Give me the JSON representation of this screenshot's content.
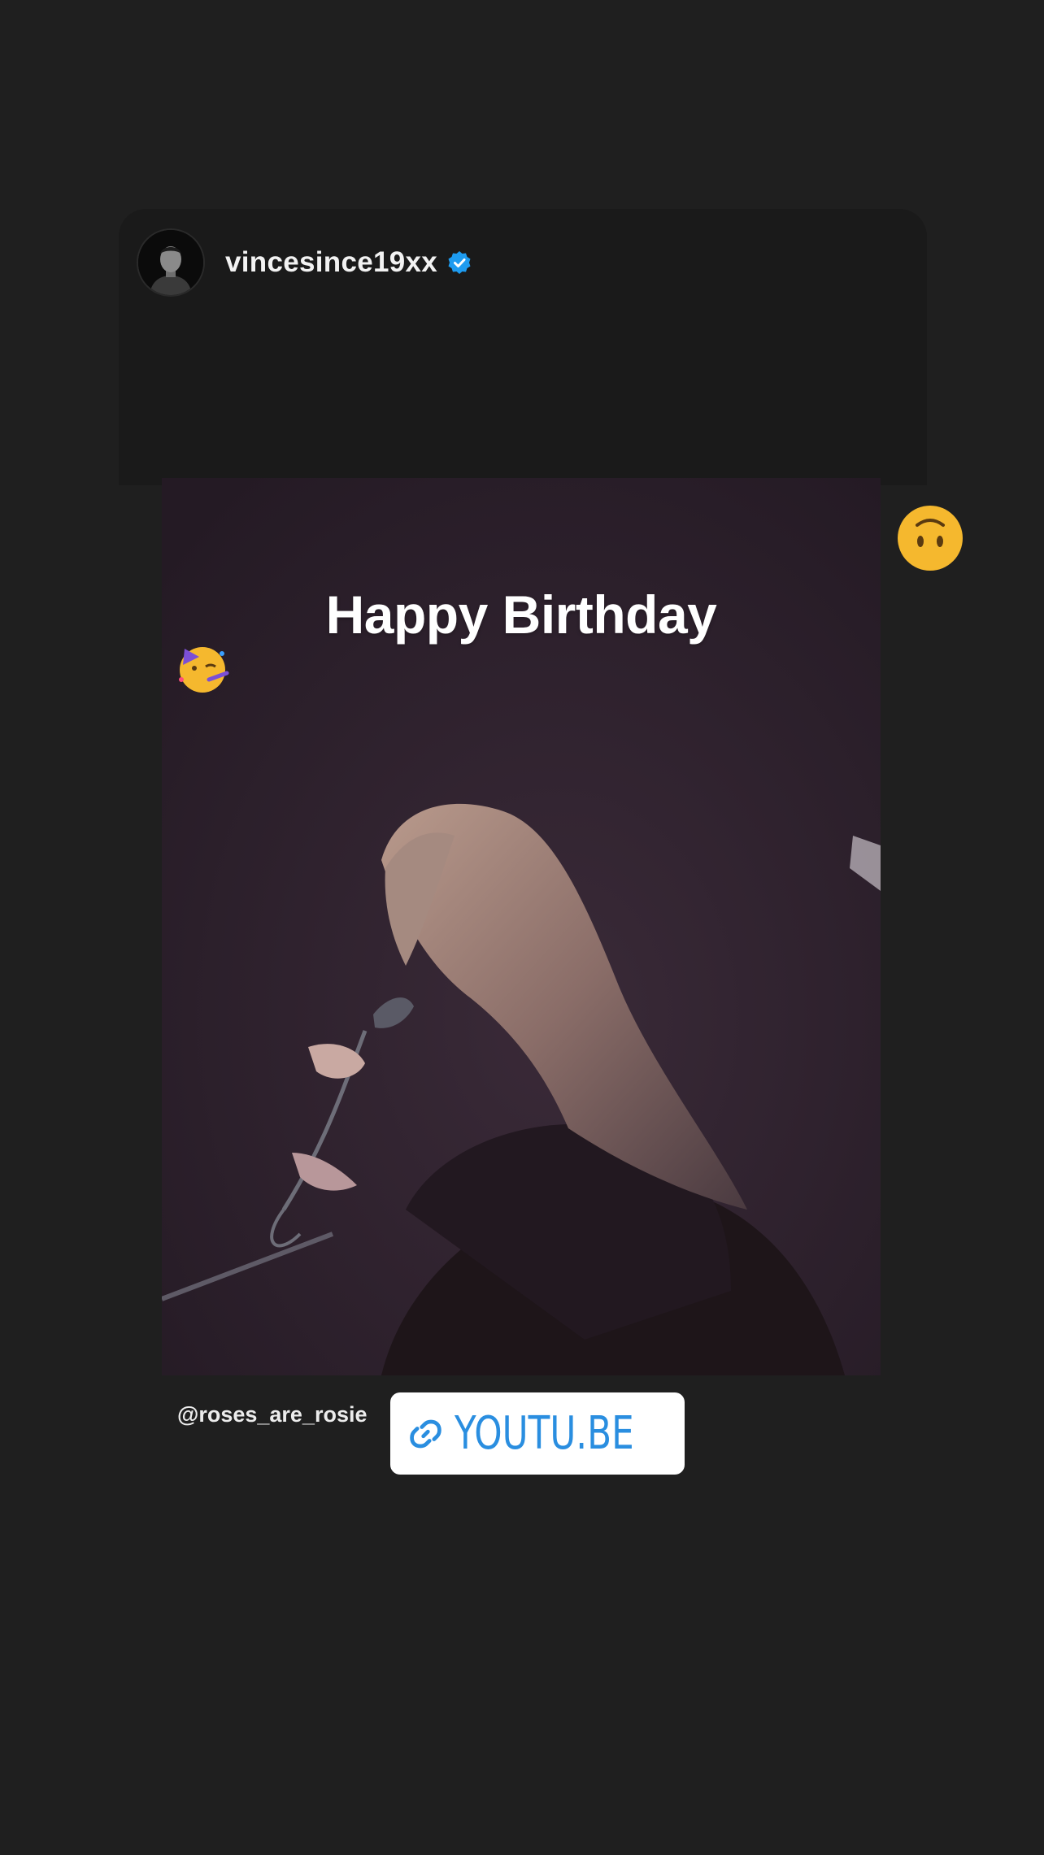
{
  "post": {
    "username": "vincesince19xx",
    "verified": true,
    "verified_color": "#1d9bf0"
  },
  "story": {
    "caption": "Happy Birthday",
    "caption_emoji": "partying-face-icon",
    "reaction_emoji": "upside-down-face-icon",
    "mention": "@roses_are_rosie",
    "link_label": "YOUTU.BE",
    "link_color": "#2a8ee0"
  },
  "colors": {
    "background": "#1f1f1f",
    "card": "#1a1a1a",
    "photo_tint": "#2b1f2b"
  }
}
